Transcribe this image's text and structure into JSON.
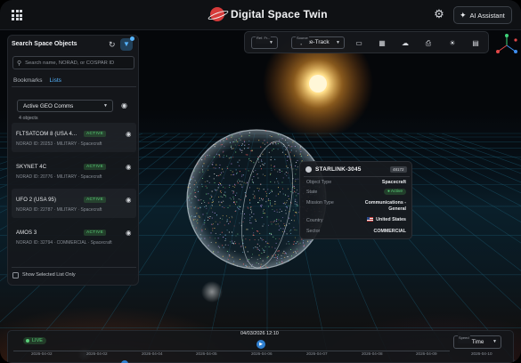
{
  "app": {
    "title": "Digital Space Twin",
    "ai_button": "AI Assistant"
  },
  "search_panel": {
    "title": "Search Space Objects",
    "search_placeholder": "Search name, NORAD, or COSPAR ID",
    "tabs": [
      {
        "label": "Bookmarks",
        "active": false
      },
      {
        "label": "Lists",
        "active": true
      }
    ],
    "selected_list": "Active GEO Comms",
    "object_count": "4 objects",
    "items": [
      {
        "name": "FLTSATCOM 8 (USA 4...",
        "status": "ACTIVE",
        "details": "NORAD ID: 20253 · MILITARY · Spacecraft"
      },
      {
        "name": "SKYNET 4C",
        "status": "ACTIVE",
        "details": "NORAD ID: 20776 · MILITARY · Spacecraft"
      },
      {
        "name": "UFO 2 (USA 95)",
        "status": "ACTIVE",
        "details": "NORAD ID: 22787 · MILITARY · Spacecraft"
      },
      {
        "name": "AMOS 3",
        "status": "ACTIVE",
        "details": "NORAD ID: 32794 · COMMERCIAL · Spacecraft"
      }
    ],
    "show_selected_label": "Show Selected List Only"
  },
  "toolbar": {
    "ref_frame_caption": "Ref. Fr...",
    "ref_frame_value": "ECI",
    "source_caption": "Source",
    "source_value": "Space-Track"
  },
  "info_card": {
    "title": "STARLINK-3045",
    "id": "48172",
    "rows": [
      {
        "label": "Object Type",
        "value": "Spacecraft"
      },
      {
        "label": "State",
        "value": "Active"
      },
      {
        "label": "Mission Type",
        "value": "Communications - General"
      },
      {
        "label": "Country",
        "value": "United States"
      },
      {
        "label": "Sector",
        "value": "COMMERCIAL"
      }
    ]
  },
  "timeline": {
    "live_label": "LIVE",
    "current_time": "04/03/2026 12:10",
    "ticks": [
      "2026-04-02",
      "2026-04-02",
      "2026-04-04",
      "2026-04-05",
      "2026-04-06",
      "2026-04-07",
      "2026-04-08",
      "2026-04-09",
      "2026-04-10"
    ],
    "speed_caption": "Speed",
    "speed_value": "Real Time"
  },
  "colors": {
    "accent": "#56b4ff",
    "active_green": "#5ad07a",
    "brand_red": "#d63a3a",
    "panel_bg": "#16181c"
  },
  "icons": [
    "apps-grid-icon",
    "brand-logo-icon",
    "settings-gear-icon",
    "sparkle-icon",
    "refresh-icon",
    "filter-icon",
    "search-icon",
    "eye-icon",
    "satellite-icon",
    "flag-us-icon",
    "play-icon"
  ]
}
